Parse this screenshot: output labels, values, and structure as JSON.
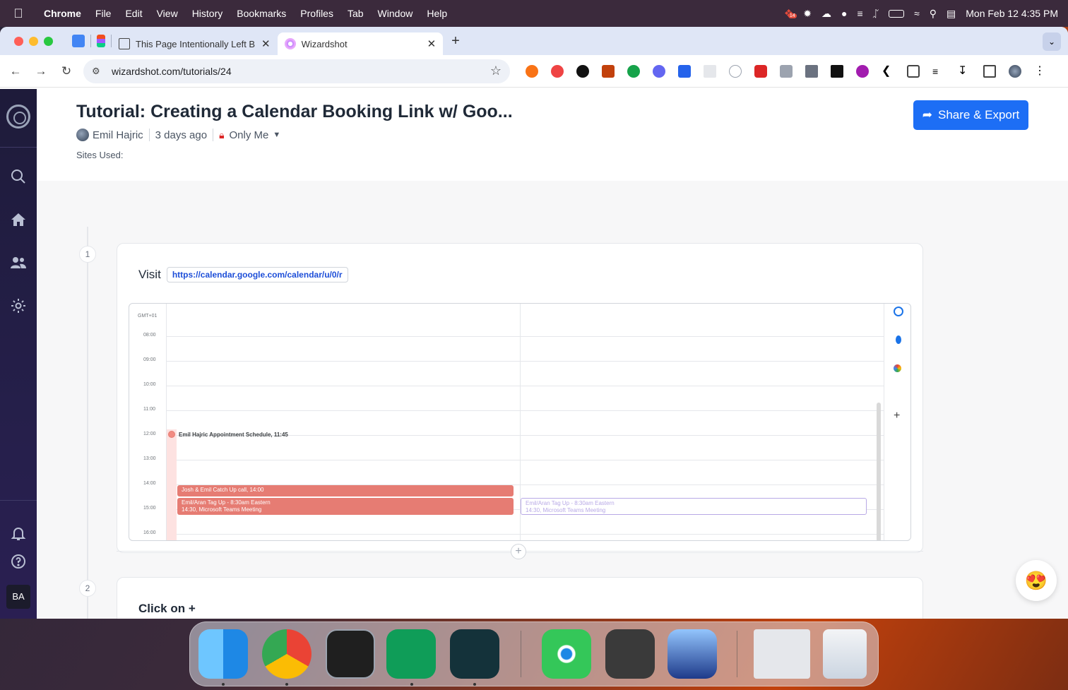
{
  "menubar": {
    "app_name": "Chrome",
    "items": [
      "File",
      "Edit",
      "View",
      "History",
      "Bookmarks",
      "Profiles",
      "Tab",
      "Window",
      "Help"
    ],
    "clock": "Mon Feb 12  4:35 PM",
    "badge_count": "14"
  },
  "browser": {
    "tabs": [
      {
        "title": "This Page Intentionally Left Bl",
        "active": false
      },
      {
        "title": "Wizardshot",
        "active": true
      }
    ],
    "url": "wizardshot.com/tutorials/24"
  },
  "sidebar": {
    "avatar_initials": "BA"
  },
  "tutorial": {
    "title": "Tutorial: Creating a Calendar Booking Link w/ Goo...",
    "author": "Emil Hajric",
    "time_ago": "3 days ago",
    "visibility": "Only Me",
    "sites_used_label": "Sites Used:",
    "share_button": "Share & Export"
  },
  "steps": [
    {
      "number": "1",
      "action": "Visit",
      "link": "https://calendar.google.com/calendar/u/0/r"
    },
    {
      "number": "2",
      "action": "Click on +"
    }
  ],
  "calendar": {
    "timezone": "GMT+01",
    "hours": [
      "08:00",
      "09:00",
      "10:00",
      "11:00",
      "12:00",
      "13:00",
      "14:00",
      "15:00",
      "16:00"
    ],
    "appointment_schedule": "Emil Hajric Appointment Schedule, 11:45",
    "event_catchup": "Josh & Emil Catch Up call, 14:00",
    "event_tagup_title": "Emil/Aran Tag Up - 8:30am Eastern",
    "event_tagup_detail": "14:30, Microsoft Teams Meeting"
  },
  "colors": {
    "accent": "#1d6ef5",
    "sidebar": "#1e1b3a",
    "event": "#e67c73"
  }
}
